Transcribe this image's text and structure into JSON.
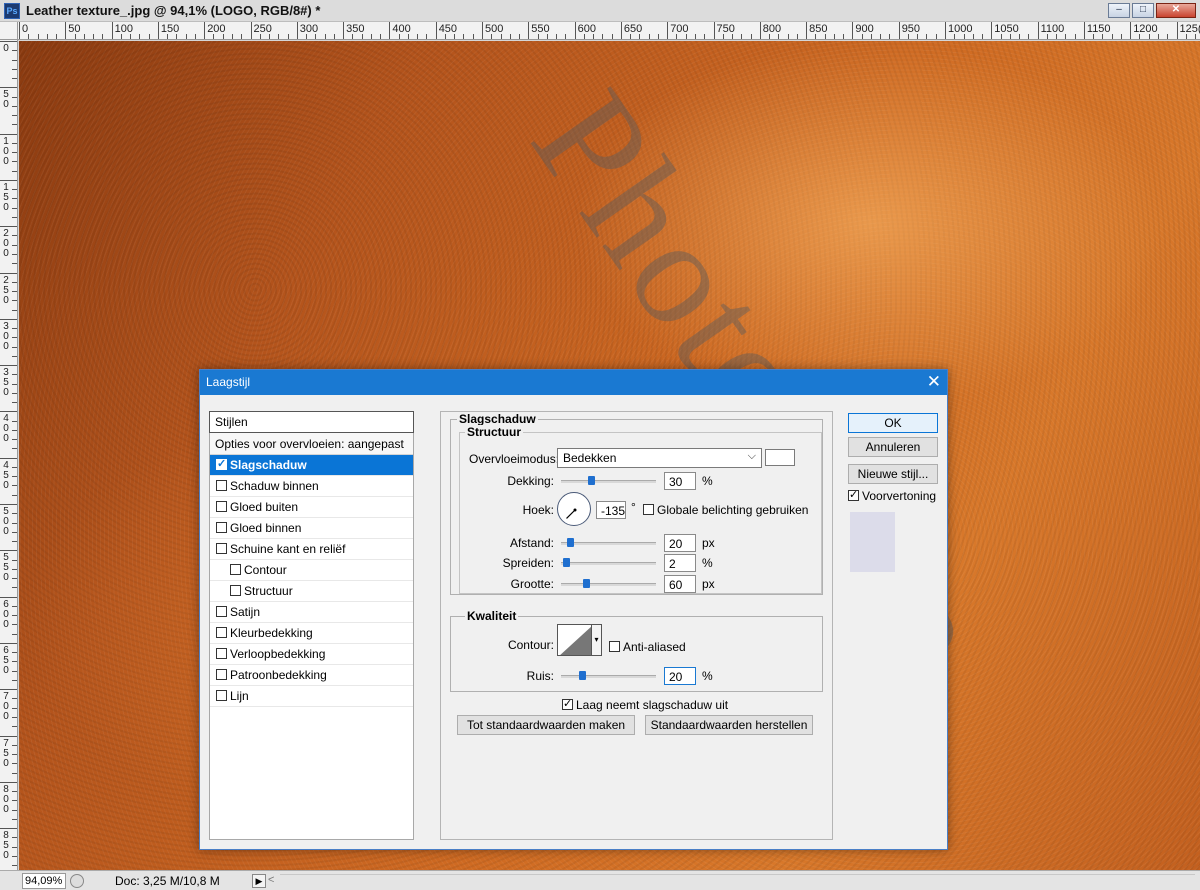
{
  "window": {
    "title": "Leather texture_.jpg @ 94,1% (LOGO, RGB/8#) *",
    "app_icon": "Ps",
    "buttons": {
      "minimize": "–",
      "maximize": "□",
      "close": "✕"
    }
  },
  "rulers": {
    "horizontal_labels": [
      "0",
      "50",
      "100",
      "150",
      "200",
      "250",
      "300",
      "350",
      "400",
      "450",
      "500",
      "550",
      "600",
      "650",
      "700",
      "750",
      "800",
      "850",
      "900",
      "950",
      "1000",
      "1050",
      "1100",
      "1150",
      "1200",
      "125("
    ],
    "vertical_labels": [
      "0",
      "50",
      "100",
      "150",
      "200",
      "250",
      "300",
      "350",
      "400",
      "450",
      "500",
      "550",
      "600",
      "650",
      "700",
      "750",
      "800",
      "850"
    ]
  },
  "watermark": {
    "text": "Photoshop"
  },
  "status": {
    "zoom": "94,09%",
    "doc": "Doc: 3,25 M/10,8 M",
    "arrow": "▶",
    "scroll_left": "<"
  },
  "dialog": {
    "title": "Laagstijl",
    "close": "✕",
    "styles": {
      "header": "Stijlen",
      "options_row": "Opties voor overvloeien: aangepast",
      "items": [
        {
          "label": "Slagschaduw",
          "checked": true,
          "selected": true,
          "indent": false
        },
        {
          "label": "Schaduw binnen",
          "checked": false,
          "selected": false,
          "indent": false
        },
        {
          "label": "Gloed buiten",
          "checked": false,
          "selected": false,
          "indent": false
        },
        {
          "label": "Gloed binnen",
          "checked": false,
          "selected": false,
          "indent": false
        },
        {
          "label": "Schuine kant en reliëf",
          "checked": false,
          "selected": false,
          "indent": false
        },
        {
          "label": "Contour",
          "checked": false,
          "selected": false,
          "indent": true
        },
        {
          "label": "Structuur",
          "checked": false,
          "selected": false,
          "indent": true
        },
        {
          "label": "Satijn",
          "checked": false,
          "selected": false,
          "indent": false
        },
        {
          "label": "Kleurbedekking",
          "checked": false,
          "selected": false,
          "indent": false
        },
        {
          "label": "Verloopbedekking",
          "checked": false,
          "selected": false,
          "indent": false
        },
        {
          "label": "Patroonbedekking",
          "checked": false,
          "selected": false,
          "indent": false
        },
        {
          "label": "Lijn",
          "checked": false,
          "selected": false,
          "indent": false
        }
      ]
    },
    "panel": {
      "section_title": "Slagschaduw",
      "structure_title": "Structuur",
      "blend_label": "Overvloeimodus:",
      "blend_value": "Bedekken",
      "blend_color": "#ffffff",
      "opacity_label": "Dekking:",
      "opacity_value": "30",
      "opacity_fraction": 0.3,
      "opacity_unit": "%",
      "angle_label": "Hoek:",
      "angle_value": "-135",
      "angle_deg": -135,
      "angle_unit": "°",
      "global_light_label": "Globale belichting gebruiken",
      "distance_label": "Afstand:",
      "distance_value": "20",
      "distance_fraction": 0.067,
      "distance_unit": "px",
      "spread_label": "Spreiden:",
      "spread_value": "2",
      "spread_fraction": 0.02,
      "spread_unit": "%",
      "size_label": "Grootte:",
      "size_value": "60",
      "size_fraction": 0.24,
      "size_unit": "px",
      "quality_title": "Kwaliteit",
      "contour_label": "Contour:",
      "antialias_label": "Anti-aliased",
      "noise_label": "Ruis:",
      "noise_value": "20",
      "noise_fraction": 0.2,
      "noise_unit": "%",
      "knockout_label": "Laag neemt slagschaduw uit",
      "make_default": "Tot standaardwaarden maken",
      "reset_default": "Standaardwaarden herstellen"
    },
    "buttons": {
      "ok": "OK",
      "cancel": "Annuleren",
      "new_style": "Nieuwe stijl...",
      "preview_label": "Voorvertoning"
    }
  },
  "colors": {
    "accent": "#1a79d2",
    "selection": "#0a75d6",
    "slider_thumb": "#1f6fcf"
  }
}
